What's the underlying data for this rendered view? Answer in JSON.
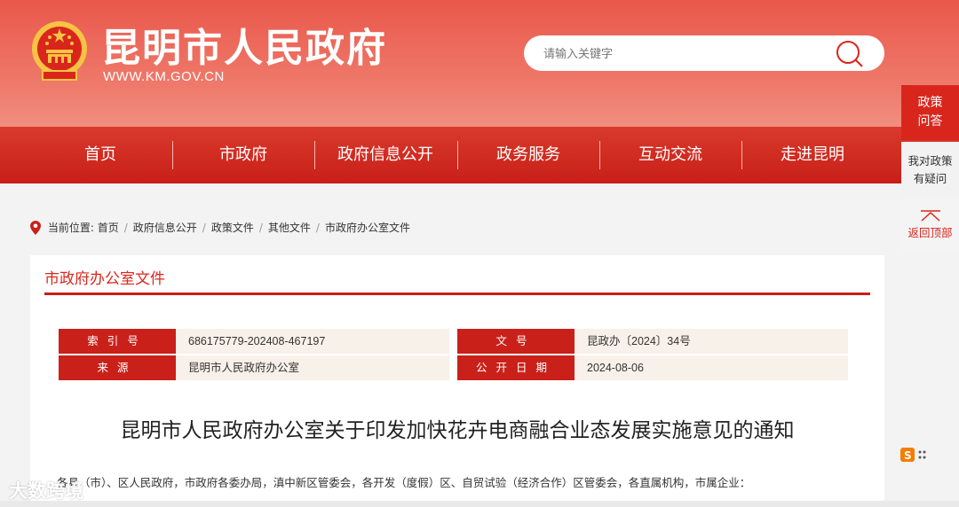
{
  "header": {
    "title": "昆明市人民政府",
    "url": "WWW.KM.GOV.CN",
    "search_placeholder": "请输入关键字"
  },
  "nav": {
    "items": [
      "首页",
      "市政府",
      "政府信息公开",
      "政务服务",
      "互动交流",
      "走进昆明"
    ]
  },
  "float": {
    "policy_line1": "政策",
    "policy_line2": "问答",
    "ask_line1": "我对政策",
    "ask_line2": "有疑问",
    "top_label": "返回顶部"
  },
  "breadcrumb": {
    "label": "当前位置:",
    "items": [
      "首页",
      "政府信息公开",
      "政策文件",
      "其他文件",
      "市政府办公室文件"
    ]
  },
  "panel": {
    "title": "市政府办公室文件"
  },
  "meta": {
    "index_key": "索引号",
    "index_value": "686175779-202408-467197",
    "docno_key": "文号",
    "docno_value": "昆政办〔2024〕34号",
    "source_key": "来源",
    "source_value": "昆明市人民政府办公室",
    "date_key": "公开日期",
    "date_value": "2024-08-06"
  },
  "document": {
    "title": "昆明市人民政府办公室关于印发加快花卉电商融合业态发展实施意见的通知",
    "salutation": "各县（市）、区人民政府，市政府各委办局，滇中新区管委会，各开发（度假）区、自贸试验（经济合作）区管委会，各直属机构，市属企业："
  },
  "watermark": "大数跨境",
  "colors": {
    "brand_red": "#c81f18",
    "header_light": "#ef7b6c"
  }
}
